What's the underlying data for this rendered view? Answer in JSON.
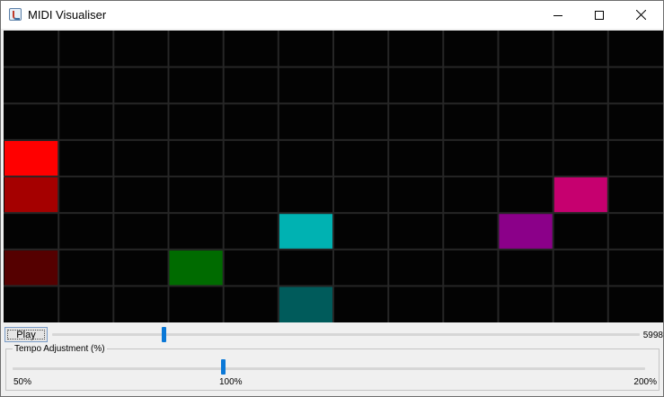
{
  "window": {
    "title": "MIDI Visualiser",
    "controls": [
      "minimize-icon",
      "maximize-icon",
      "close-icon"
    ]
  },
  "visualiser": {
    "background": "#030303",
    "grid_color": "#262626",
    "columns": 12,
    "rows": 8,
    "active_cells": [
      {
        "col": 0,
        "row": 3,
        "color": "#ff0000"
      },
      {
        "col": 0,
        "row": 4,
        "color": "#a50000"
      },
      {
        "col": 0,
        "row": 6,
        "color": "#550000"
      },
      {
        "col": 3,
        "row": 6,
        "color": "#006b00"
      },
      {
        "col": 5,
        "row": 5,
        "color": "#00b2b2"
      },
      {
        "col": 5,
        "row": 7,
        "color": "#005b5b"
      },
      {
        "col": 9,
        "row": 5,
        "color": "#8b0089"
      },
      {
        "col": 10,
        "row": 4,
        "color": "#c6006f"
      }
    ]
  },
  "playback": {
    "play_label": "Play",
    "position_fraction": 0.19,
    "position_value": "5998"
  },
  "tempo": {
    "legend": "Tempo Adjustment (%)",
    "value_fraction": 0.3333,
    "min_label": "50%",
    "mid_label": "100%",
    "max_label": "200%"
  },
  "colors": {
    "accent": "#0a78d7"
  }
}
